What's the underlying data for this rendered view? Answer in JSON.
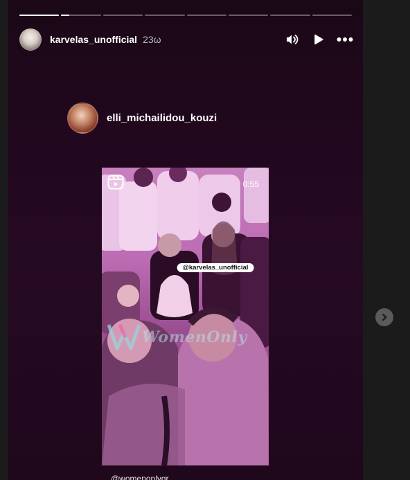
{
  "story": {
    "progress": [
      {
        "fill": 1.0
      },
      {
        "fill": 0.2
      },
      {
        "fill": 0.0
      },
      {
        "fill": 0.0
      },
      {
        "fill": 0.0
      },
      {
        "fill": 0.0
      },
      {
        "fill": 0.0
      },
      {
        "fill": 0.0
      }
    ],
    "author": {
      "username": "karvelas_unofficial",
      "time": "23ω"
    },
    "icons": [
      "speaker-icon",
      "play-icon",
      "more-icon"
    ]
  },
  "repost": {
    "username": "elli_michailidou_kouzi"
  },
  "reel": {
    "duration": "0:55",
    "tag": "@karvelas_unofficial",
    "watermark": "WomenOnly",
    "credit": "@womenonlygr"
  },
  "colors": {
    "accent_pink": "#c768b6",
    "story_bg": "#22081e"
  }
}
